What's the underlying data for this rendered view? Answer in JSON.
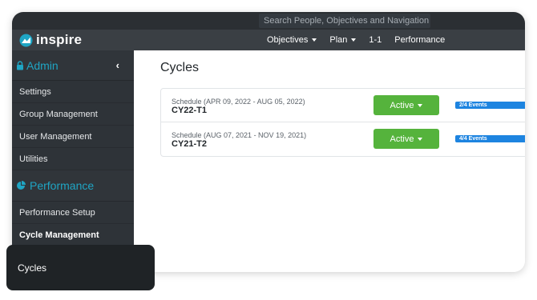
{
  "topbar": {
    "search_placeholder": "Search People, Objectives and Navigation"
  },
  "navbar": {
    "logo_text": "inspire",
    "items": [
      {
        "label": "Objectives",
        "has_caret": true
      },
      {
        "label": "Plan",
        "has_caret": true
      },
      {
        "label": "1-1",
        "has_caret": false
      },
      {
        "label": "Performance",
        "has_caret": false
      }
    ]
  },
  "sidebar": {
    "admin_header": "Admin",
    "admin_items": [
      "Settings",
      "Group Management",
      "User Management",
      "Utilities"
    ],
    "performance_header": "Performance",
    "performance_items": [
      "Performance Setup",
      "Cycle Management"
    ]
  },
  "main": {
    "title": "Cycles",
    "cycles": [
      {
        "schedule": "Schedule (APR 09, 2022 - AUG 05, 2022)",
        "name": "CY22-T1",
        "status": "Active",
        "events": "2/4 Events"
      },
      {
        "schedule": "Schedule (AUG 07, 2021 - NOV 19, 2021)",
        "name": "CY21-T2",
        "status": "Active",
        "events": "4/4 Events"
      }
    ]
  },
  "popup": {
    "label": "Cycles"
  },
  "colors": {
    "accent": "#1fa5c4",
    "active_button": "#55b33c",
    "event_badge": "#1d84e0",
    "sidebar_bg": "#2e3338",
    "navbar_bg": "#3a3f44"
  }
}
